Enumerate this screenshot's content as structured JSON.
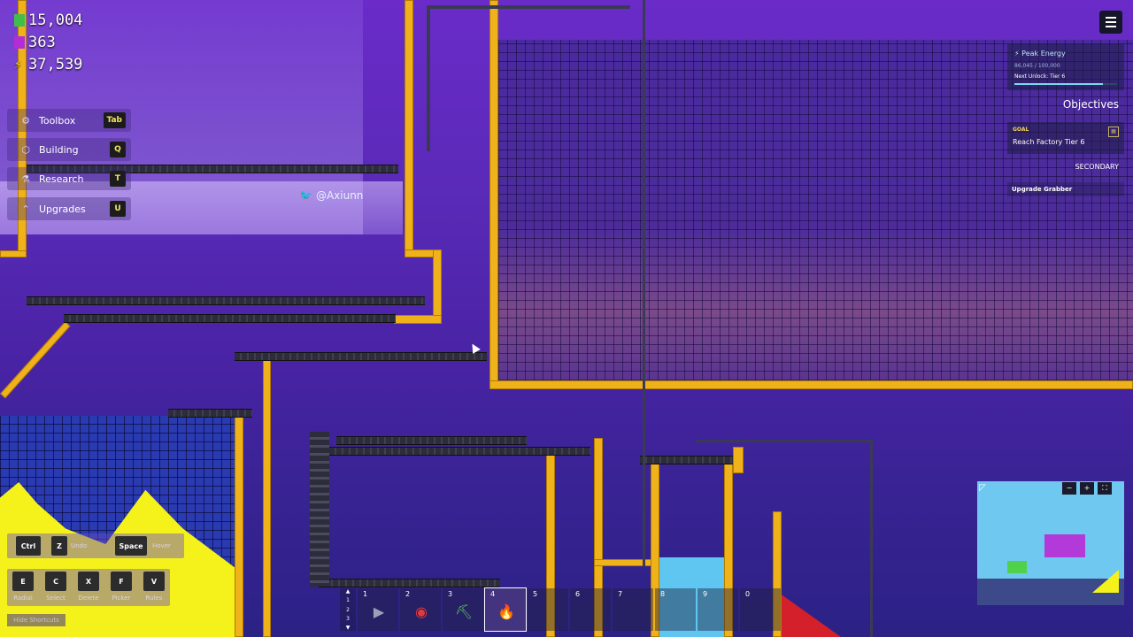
{
  "resources": [
    {
      "name": "coins",
      "value": "15,004",
      "color": "#3fbf4a",
      "icon": "stack-icon"
    },
    {
      "name": "research",
      "value": "363",
      "color": "#b32dd6",
      "icon": "crystal-icon"
    },
    {
      "name": "energy",
      "value": "37,539",
      "color": "#f3d21a",
      "icon": "lightning-icon"
    }
  ],
  "menu": [
    {
      "label": "Toolbox",
      "key": "Tab",
      "icon": "wrench-icon",
      "glyph": "⚙"
    },
    {
      "label": "Building",
      "key": "Q",
      "icon": "cube-icon",
      "glyph": "⬡"
    },
    {
      "label": "Research",
      "key": "T",
      "icon": "flask-icon",
      "glyph": "⚗"
    },
    {
      "label": "Upgrades",
      "key": "U",
      "icon": "arrow-up-icon",
      "glyph": "⌃"
    }
  ],
  "credit": {
    "handle": "@Axiunn",
    "icon": "twitter-icon"
  },
  "energy_panel": {
    "title": "Peak Energy",
    "value": "86,045 / 100,000",
    "next_unlock": "Next Unlock: Tier 6",
    "progress": 0.86
  },
  "objectives": {
    "title": "Objectives",
    "goal_label": "GOAL",
    "goal_text": "Reach Factory Tier 6",
    "secondary_label": "SECONDARY",
    "secondary_items": [
      "Upgrade Grabber"
    ]
  },
  "shortcuts": {
    "row1": [
      {
        "key": "Ctrl"
      },
      {
        "key": "Z",
        "label": "Undo"
      },
      {
        "key": "Space",
        "label": "Hover"
      }
    ],
    "row2": [
      {
        "key": "E",
        "label": "Radial"
      },
      {
        "key": "C",
        "label": "Select"
      },
      {
        "key": "X",
        "label": "Delete"
      },
      {
        "key": "F",
        "label": "Picker"
      },
      {
        "key": "V",
        "label": "Rules"
      }
    ],
    "hide": "Hide Shortcuts"
  },
  "hotbar": {
    "nav": [
      "1",
      "2",
      "3"
    ],
    "slots": [
      {
        "num": "1",
        "icon": "conveyor-icon",
        "glyph": "▶"
      },
      {
        "num": "2",
        "icon": "grabber-icon",
        "glyph": "◉"
      },
      {
        "num": "3",
        "icon": "drill-icon",
        "glyph": "⛏"
      },
      {
        "num": "4",
        "icon": "furnace-icon",
        "glyph": "🔥"
      },
      {
        "num": "5",
        "icon": "",
        "glyph": ""
      },
      {
        "num": "6",
        "icon": "",
        "glyph": ""
      },
      {
        "num": "7",
        "icon": "",
        "glyph": ""
      },
      {
        "num": "8",
        "icon": "",
        "glyph": ""
      },
      {
        "num": "9",
        "icon": "",
        "glyph": ""
      },
      {
        "num": "0",
        "icon": "",
        "glyph": ""
      }
    ],
    "active": 3
  },
  "minimap": {
    "buttons": [
      "−",
      "+",
      "⛶"
    ]
  }
}
